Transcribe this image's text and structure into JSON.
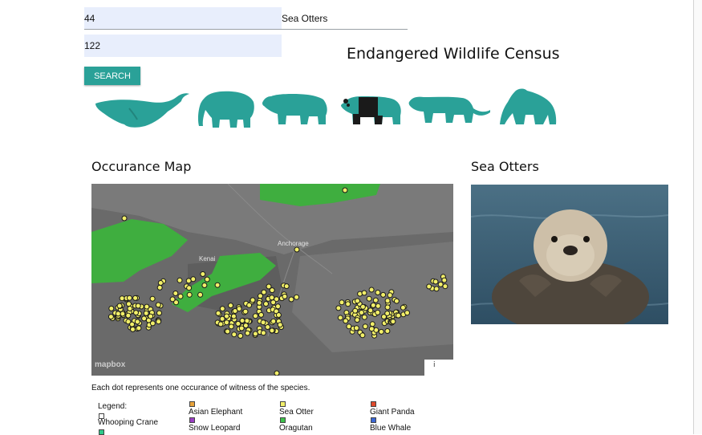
{
  "search": {
    "latitude_value": "44",
    "longitude_value": "122",
    "species_value": "Sea Otters",
    "button_label": "SEARCH"
  },
  "page": {
    "title": "Endangered Wildlife Census"
  },
  "animals": [
    {
      "name": "whale-icon"
    },
    {
      "name": "elephant-icon"
    },
    {
      "name": "bear-icon"
    },
    {
      "name": "panda-icon"
    },
    {
      "name": "tiger-icon"
    },
    {
      "name": "gorilla-icon"
    }
  ],
  "map_section": {
    "heading": "Occurance Map",
    "labels": [
      "Anchorage",
      "Kenai"
    ],
    "attribution": "mapbox",
    "info_glyph": "i",
    "caption": "Each dot represents one occurance of witness of the species."
  },
  "photo_section": {
    "heading": "Sea Otters"
  },
  "legend": {
    "title": "Legend:",
    "items": [
      {
        "label": "Whooping Crane",
        "color": "#ffffff"
      },
      {
        "label": "Asian Elephant",
        "color": "#e8a33a"
      },
      {
        "label": "Snow Leopard",
        "color": "#9b3fc4"
      },
      {
        "label": "Sea Otter",
        "color": "#f2ef6a"
      },
      {
        "label": "Oragutan",
        "color": "#3cc24a"
      },
      {
        "label": "Giant Panda",
        "color": "#e04a2c"
      },
      {
        "label": "Blue Whale",
        "color": "#3a66d4"
      },
      {
        "label": "",
        "color": "#2ec98a"
      }
    ]
  },
  "colors": {
    "accent": "#2aa198",
    "input_bg": "#e8eefc",
    "map_bg": "#6c6c6c",
    "habitat_green": "#3fae3f",
    "dot_yellow": "#f2ef6a"
  }
}
